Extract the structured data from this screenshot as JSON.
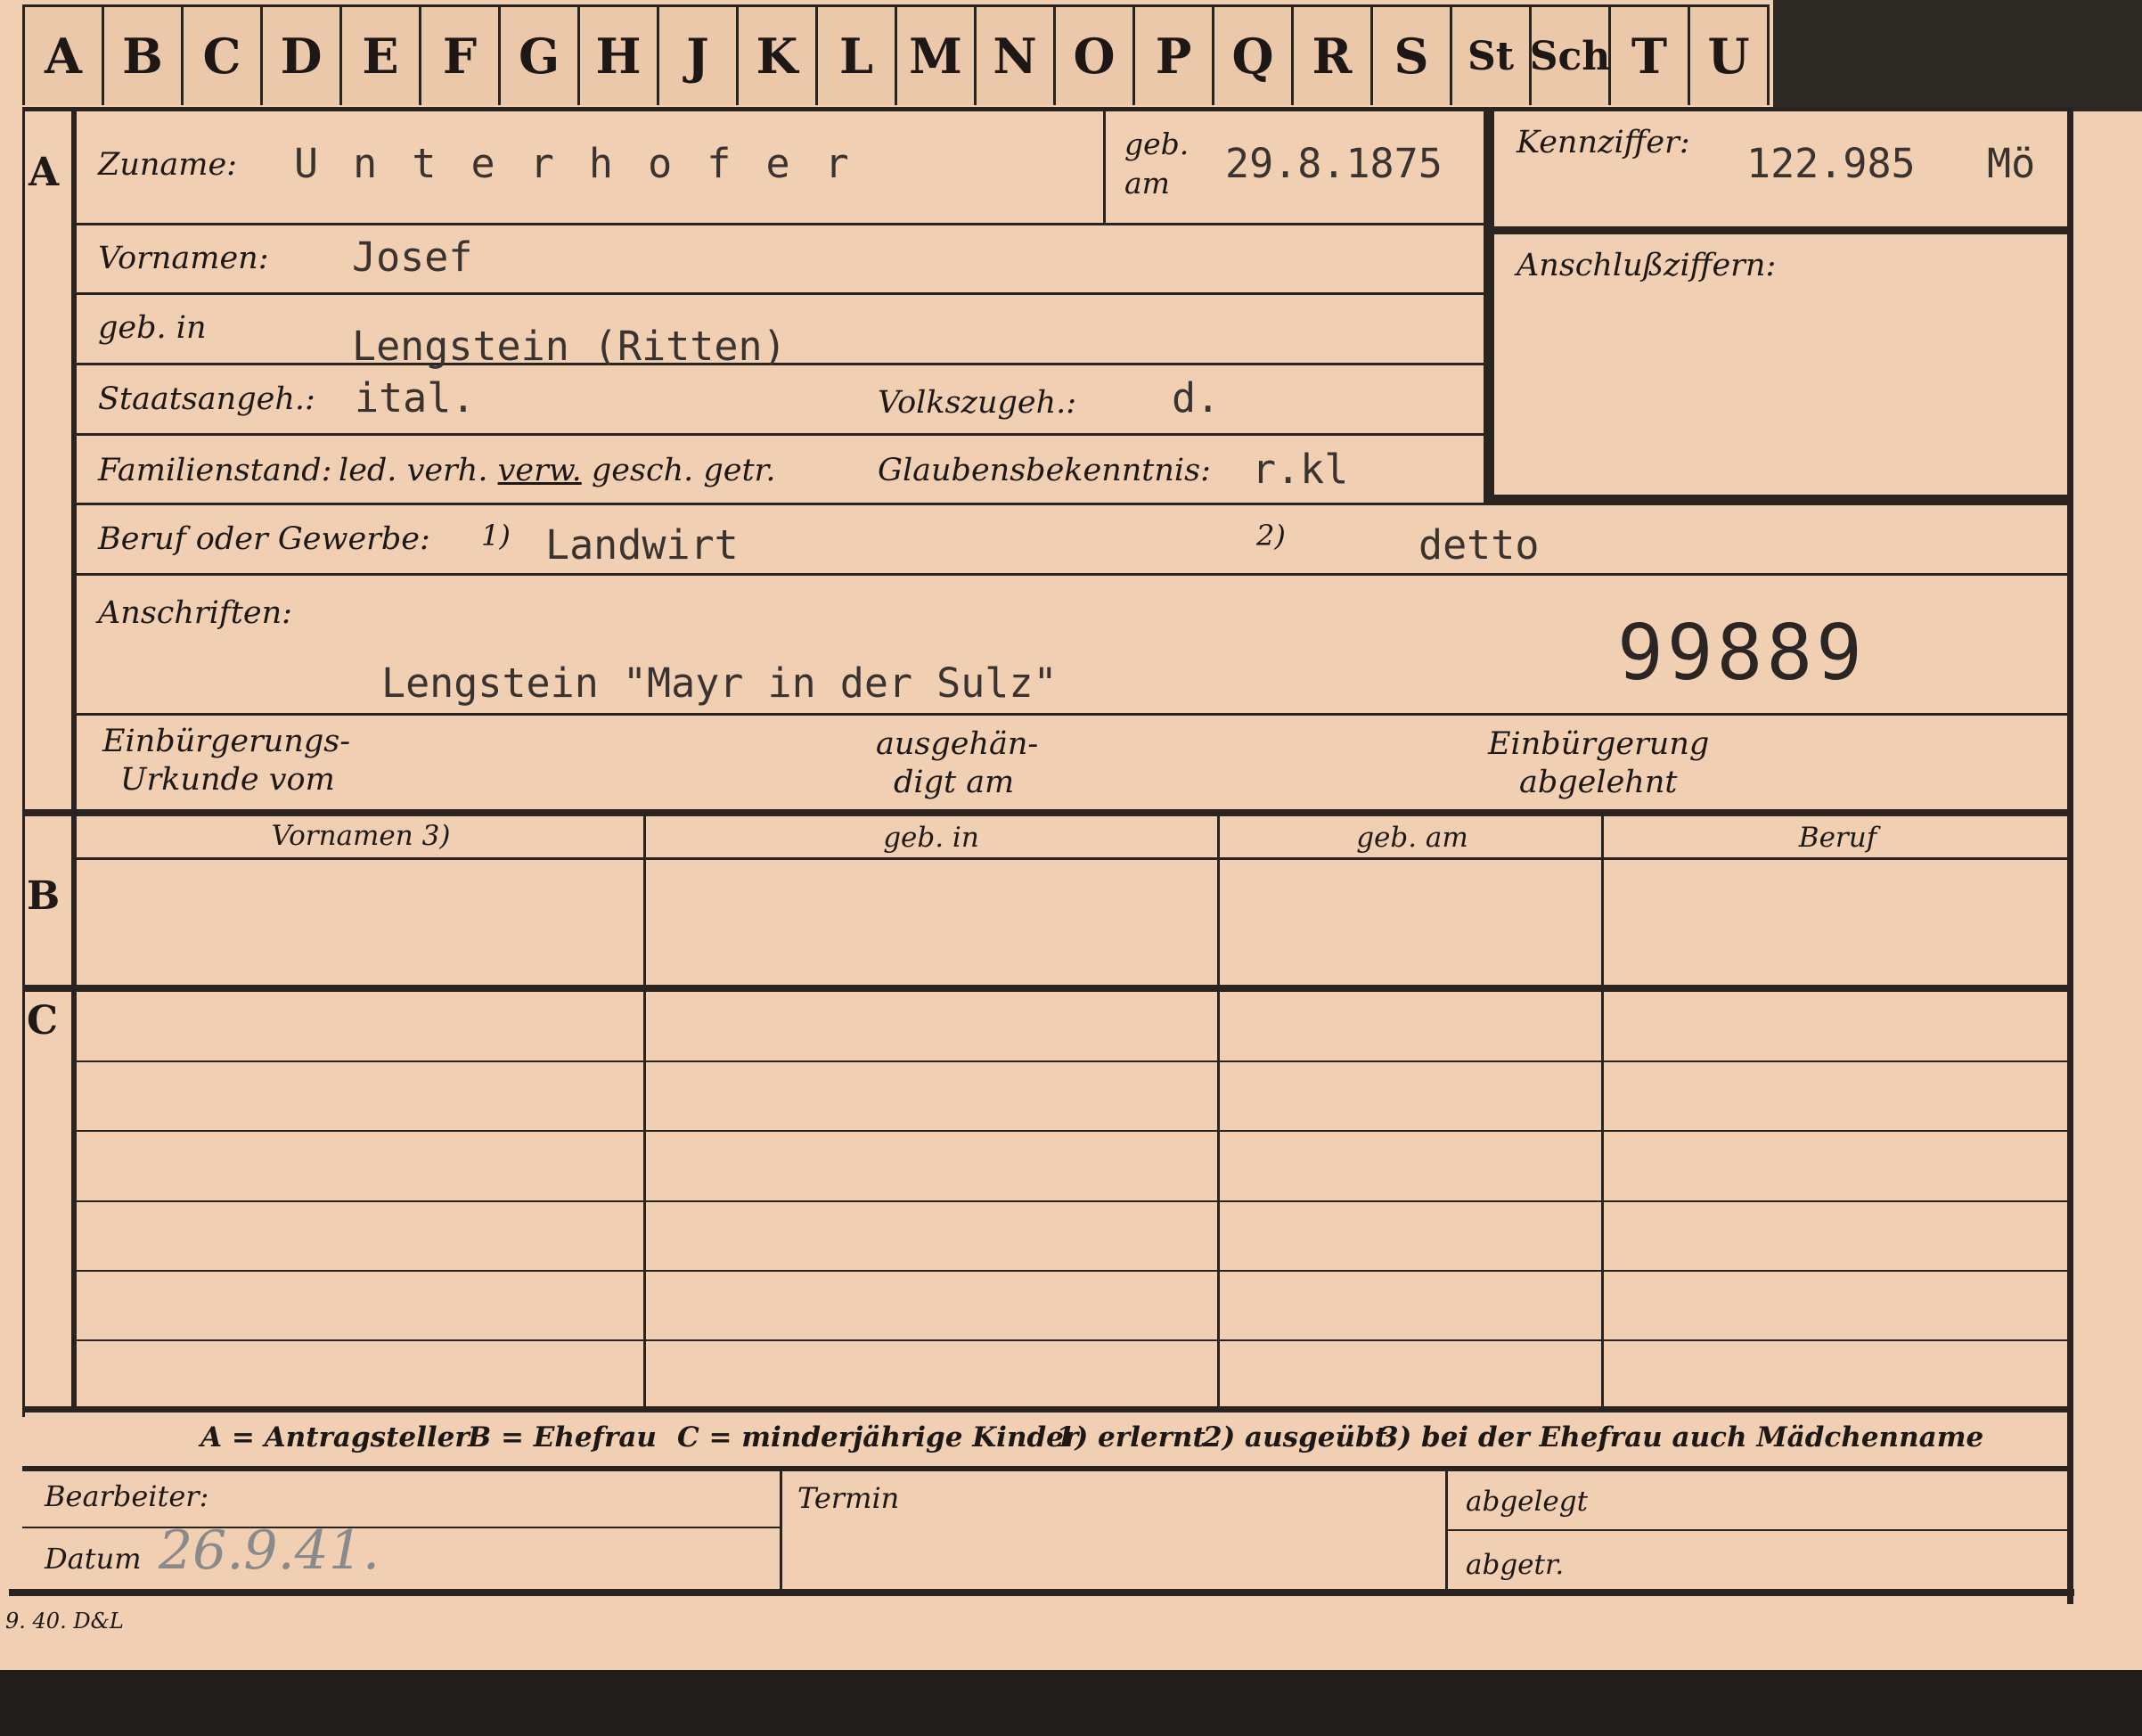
{
  "alphabet_tabs": [
    "A",
    "B",
    "C",
    "D",
    "E",
    "F",
    "G",
    "H",
    "J",
    "K",
    "L",
    "M",
    "N",
    "O",
    "P",
    "Q",
    "R",
    "S",
    "St",
    "Sch",
    "T",
    "U"
  ],
  "section_a": {
    "marker": "A",
    "surname": {
      "label": "Zuname:",
      "value": "U n t e r h o f e r"
    },
    "birth_date": {
      "label_line1": "geb.",
      "label_line2": "am",
      "value": "29.8.1875"
    },
    "id_number": {
      "label": "Kennziffer:",
      "value": "122.985",
      "suffix": "Mö"
    },
    "linked_numbers": {
      "label": "Anschlußziffern:"
    },
    "first_names": {
      "label": "Vornamen:",
      "value": "Josef"
    },
    "birth_place": {
      "label": "geb. in",
      "value": "Lengstein (Ritten)"
    },
    "citizenship": {
      "label": "Staatsangeh.:",
      "value": "ital."
    },
    "ethnicity": {
      "label": "Volkszugeh.:",
      "value": "d."
    },
    "marital_status": {
      "label": "Familienstand:",
      "options_text": "led. verh.",
      "options_selected": "verw.",
      "options_rest": "gesch. getr."
    },
    "religion": {
      "label": "Glaubensbekenntnis:",
      "value": "r.kl"
    },
    "occupation": {
      "label": "Beruf oder Gewerbe:",
      "mark1": "1)",
      "value1": "Landwirt",
      "mark2": "2)",
      "value2": "detto"
    },
    "addresses": {
      "label": "Anschriften:",
      "value": "Lengstein \"Mayr in der Sulz\"",
      "stamp_number": "99889"
    },
    "naturalization": {
      "doc_line1": "Einbürgerungs-",
      "doc_line2": "Urkunde vom",
      "handed_line1": "ausgehän-",
      "handed_line2": "digt am",
      "rejected_line1": "Einbürgerung",
      "rejected_line2": "abgelehnt"
    }
  },
  "section_b": {
    "marker": "B",
    "columns": [
      "Vornamen 3)",
      "geb. in",
      "geb. am",
      "Beruf"
    ]
  },
  "section_c": {
    "marker": "C"
  },
  "legend": {
    "a": "A = Antragsteller",
    "b": "B = Ehefrau",
    "c": "C = minderjährige Kinder",
    "n1": "1) erlernt",
    "n2": "2) ausgeübt",
    "n3": "3) bei der Ehefrau auch Mädchenname"
  },
  "footer": {
    "processor": "Bearbeiter:",
    "date_label": "Datum",
    "date_value": "26.9.41.",
    "deadline": "Termin",
    "filed": "abgelegt",
    "forwarded": "abgetr."
  },
  "print_code": "9. 40. D&L"
}
